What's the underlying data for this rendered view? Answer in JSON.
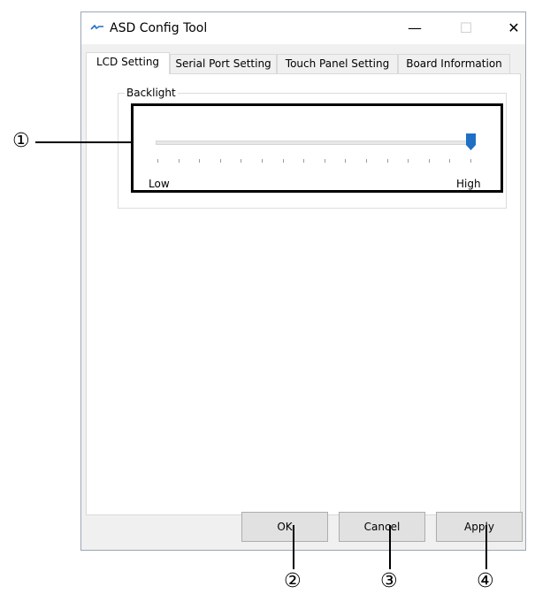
{
  "window": {
    "title": "ASD Config Tool",
    "minimize_glyph": "—",
    "maximize_glyph": "☐",
    "close_glyph": "✕"
  },
  "tabs": [
    {
      "label": "LCD Setting",
      "active": true
    },
    {
      "label": "Serial Port Setting",
      "active": false
    },
    {
      "label": "Touch Panel Setting",
      "active": false
    },
    {
      "label": "Board Information",
      "active": false
    }
  ],
  "backlight": {
    "group_label": "Backlight",
    "low_label": "Low",
    "high_label": "High",
    "value_fraction": 1.0,
    "tick_count": 16
  },
  "buttons": {
    "ok": "OK",
    "cancel": "Cancel",
    "apply": "Apply"
  },
  "callouts": [
    "①",
    "②",
    "③",
    "④"
  ],
  "colors": {
    "thumb": "#1f6fc5",
    "callout": "#000000"
  }
}
